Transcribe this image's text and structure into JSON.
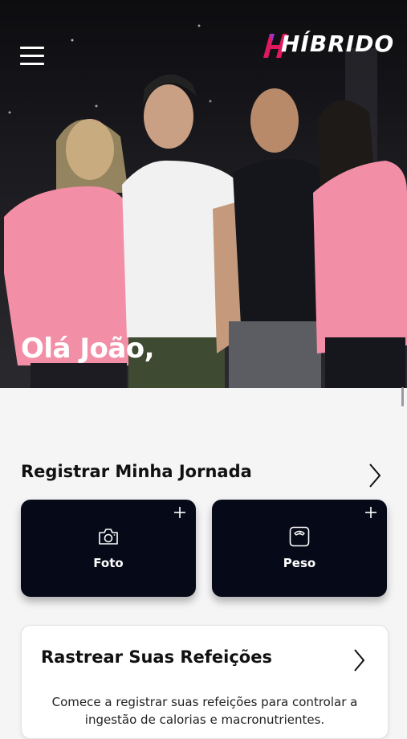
{
  "header": {
    "logo_text": "HÍBRIDO",
    "menu_icon": "hamburger-menu-icon"
  },
  "hero": {
    "greeting": "Olá João,"
  },
  "journey": {
    "title": "Registrar Minha Jornada",
    "cards": [
      {
        "label": "Foto",
        "icon": "camera-icon"
      },
      {
        "label": "Peso",
        "icon": "scale-icon"
      }
    ]
  },
  "meals": {
    "title": "Rastrear Suas Refeições",
    "description": "Comece a registrar suas refeições para controlar a ingestão de calorias e macronutrientes."
  },
  "colors": {
    "card_bg": "#060917",
    "brand_accent": "#e0195e",
    "page_bg": "#f5f5f6"
  }
}
